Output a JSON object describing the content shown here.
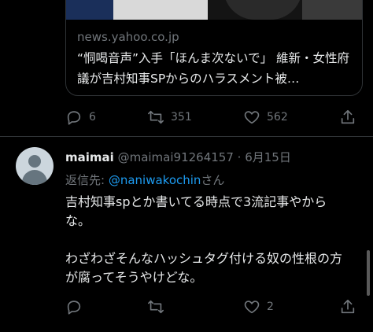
{
  "previous_tweet": {
    "link_card": {
      "domain": "news.yahoo.co.jp",
      "title": "“恫喝音声”入手「ほんま次ないで」 維新・女性府議が吉村知事SPからのハラスメント被…"
    },
    "actions": {
      "reply_count": "6",
      "retweet_count": "351",
      "like_count": "562"
    }
  },
  "tweet": {
    "display_name": "maimai",
    "handle": "@maimai91264157",
    "separator": " · ",
    "date": "6月15日",
    "reply_prefix": "返信先: ",
    "reply_mention": "@naniwakochin",
    "reply_suffix": "さん",
    "body_lines": [
      "吉村知事spとか書いてる時点で3流記事やから",
      "な。",
      "",
      "わざわざそんなハッシュタグ付ける奴の性根の方",
      "が腐ってそうやけどな。"
    ],
    "actions": {
      "reply_count": "",
      "retweet_count": "",
      "like_count": "2"
    }
  },
  "colors": {
    "background": "#000000",
    "text": "#e7e9ea",
    "muted": "#71767b",
    "link": "#1d9bf0",
    "border": "#2f3336"
  }
}
